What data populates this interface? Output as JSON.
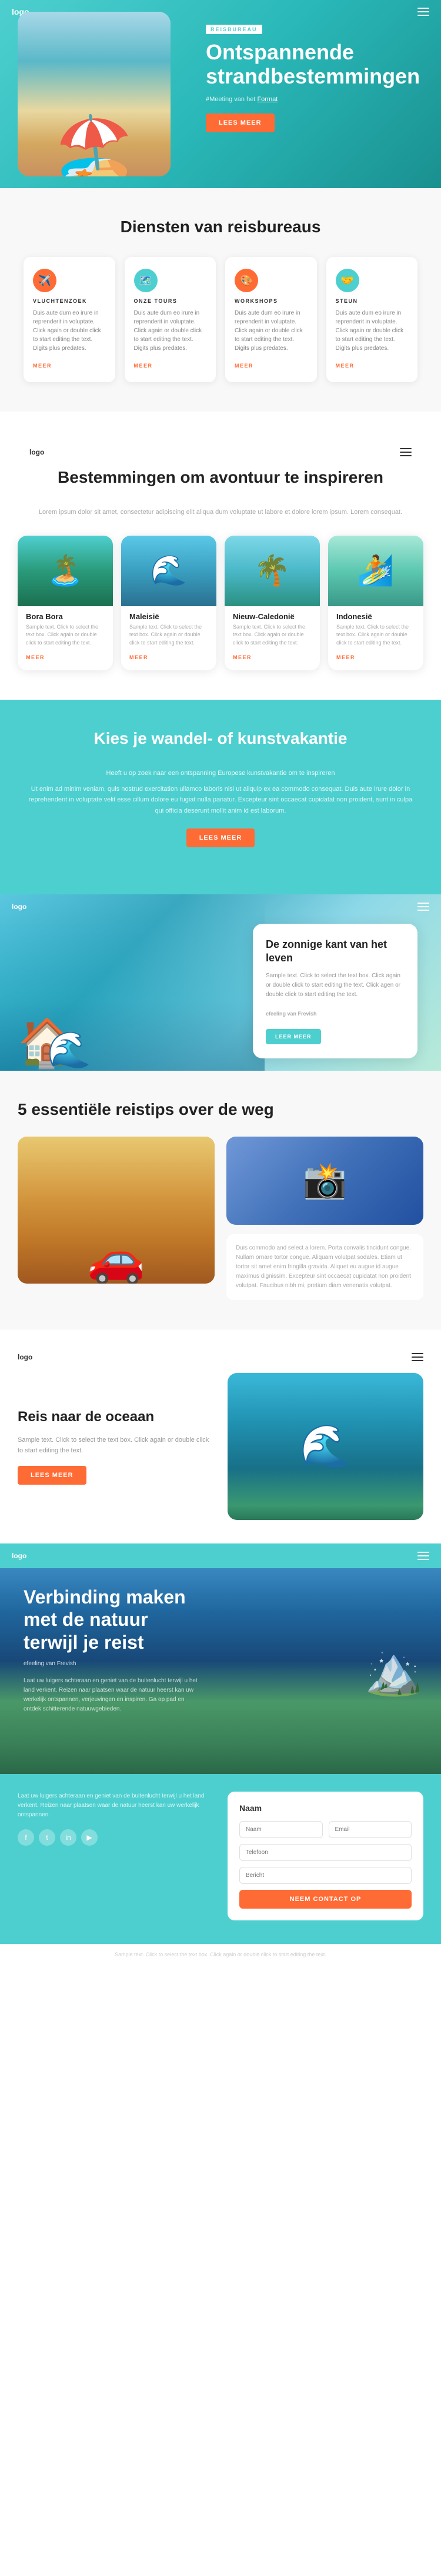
{
  "nav": {
    "logo": "logo",
    "menu_icon": "menu"
  },
  "hero": {
    "badge": "REISBUREAU",
    "title": "Ontspannende strandbestemmingen",
    "subtitle_text": "#Meeting van het",
    "subtitle_link": "Format",
    "cta_label": "LEES MEER"
  },
  "services": {
    "section_title": "Diensten van reisbureaus",
    "items": [
      {
        "id": "vluchtenzoek",
        "label": "VLUCHTENZOEK",
        "desc": "Duis aute dum eo irure in reprenderit in voluptate. Click again or double click to start editing the text. Digits plus predates.",
        "link": "MEER"
      },
      {
        "id": "onze-tours",
        "label": "ONZE TOURS",
        "desc": "Duis aute dum eo irure in reprenderit in voluptate. Click again or double click to start editing the text. Digits plus predates.",
        "link": "MEER"
      },
      {
        "id": "workshops",
        "label": "WORKSHOPS",
        "desc": "Duis aute dum eo irure in reprenderit in voluptate. Click again or double click to start editing the text. Digits plus predates.",
        "link": "MEER"
      },
      {
        "id": "steun",
        "label": "STEUN",
        "desc": "Duis aute dum eo irure in reprenderit in voluptate. Click again or double click to start editing the text. Digits plus predates.",
        "link": "MEER"
      }
    ]
  },
  "destinations": {
    "section_title": "Bestemmingen om avontuur te inspireren",
    "subtitle": "Lorem ipsum dolor sit amet, consectetur adipiscing elit aliqua dum voluptate ut labore et dolore lorem ipsum. Lorem consequat.",
    "items": [
      {
        "name": "Bora Bora",
        "desc": "Sample text. Click to select the text box. Click again or double click to start editing the text."
      },
      {
        "name": "Maleisië",
        "desc": "Sample text. Click to select the text box. Click again or double click to start editing the text."
      },
      {
        "name": "Nieuw-Caledonië",
        "desc": "Sample text. Click to select the text box. Click again or double click to start editing the text."
      },
      {
        "name": "Indonesië",
        "desc": "Sample text. Click to select the text box. Click again or double click to start editing the text."
      }
    ]
  },
  "art_vacation": {
    "section_title": "Kies je wandel- of kunstvakantie",
    "intro_text": "Heeft u op zoek naar een ontspanning Europese kunstvakantie om te inspireren",
    "body_text": "Ut enim ad minim veniam, quis nostrud exercitation ullamco laboris nisi ut aliquip ex ea commodo consequat. Duis aute irure dolor in reprehenderit in voluptate velit esse cillum dolore eu fugiat nulla pariatur. Excepteur sint occaecat cupidatat non proident, sunt in culpa qui officia deserunt mollit anim id est laborum.",
    "cta_label": "LEES MEER"
  },
  "sunny": {
    "badge": "De zonnige kant van het leven",
    "desc": "Sample text. Click to select the text box. Click again or double click to start editing the text. Click agen or double click to start editing the text.",
    "subtitle": "efeeling van Frevish",
    "cta_label": "LEER MEER"
  },
  "tips": {
    "section_title": "5 essentiële reistips over de weg",
    "body_text": "Duis commodo and select a lorem. Porta convalis tincidunt congue. Nullam ornare tortor congue. Aliquam volutpat sodales. Etiam ut tortor sit amet enim fringilla gravida. Aliquet eu augue id augue maximus dignissim. Excepteur sint occaecat cupidatat non proident volutpat. Faucibus nibh mi, pretium diam venenatis volutpat."
  },
  "ocean": {
    "logo": "logo",
    "section_title": "Reis naar de oceaan",
    "desc": "Sample text. Click to select the text box. Click again or double click to start editing the text.",
    "cta_label": "LEES MEER"
  },
  "nature": {
    "logo": "logo",
    "section_title": "Verbinding maken met de natuur terwijl je reist",
    "subtitle_text": "efeeling van Frevish",
    "desc": "Laat uw luigers achteraan en geniet van de buitenlucht terwijl u het land verkent. Reizen naar plaatsen waar de natuur heerst kan uw werkelijk ontspannen, verjeuvingen en inspiren. Ga op pad en ontdek schitterende natuuwgebieden."
  },
  "contact": {
    "form_title": "Naam",
    "fields": {
      "name_placeholder": "Naam",
      "email_placeholder": "Email",
      "phone_placeholder": "Telefoon",
      "message_placeholder": "Bericht"
    },
    "submit_label": "NEEM CONTACT OP",
    "left_text": "Laat uw luigers achteraan en geniet van de buitenlucht terwijl u het land verkent. Reizen naar plaatsen waar de natuur heerst kan uw werkelijk ontspannen."
  },
  "footer": {
    "text": "Sample text. Click to select the text box. Click again or double click to start editing the text."
  }
}
